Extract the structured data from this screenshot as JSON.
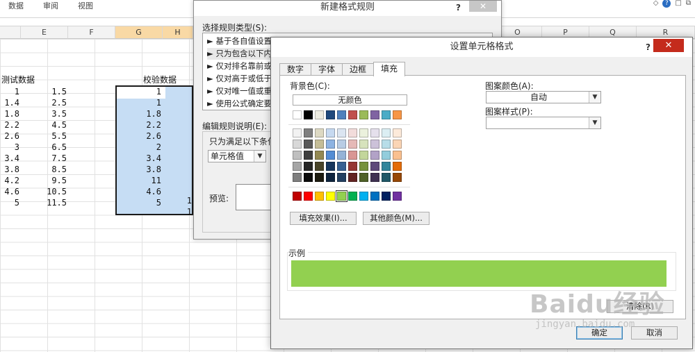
{
  "excel": {
    "ribbon_tabs": [
      "数据",
      "审阅",
      "视图"
    ],
    "columns_left": [
      "E",
      "F",
      "G",
      "H"
    ],
    "columns_right": [
      "O",
      "P",
      "Q",
      "R"
    ],
    "header_test": "测试数据",
    "header_check": "校验数据",
    "col_d": [
      "1",
      "1.4",
      "1.8",
      "2.2",
      "2.6",
      "3",
      "3.4",
      "3.8",
      "4.2",
      "4.6",
      "5"
    ],
    "col_e": [
      "1.5",
      "2.5",
      "3.5",
      "4.5",
      "5.5",
      "6.5",
      "7.5",
      "8.5",
      "9.5",
      "10.5",
      "11.5"
    ],
    "col_g": [
      "1",
      "1",
      "1.8",
      "2.2",
      "2.6",
      "2",
      "3.4",
      "3.8",
      "11",
      "4.6",
      "5"
    ],
    "col_h_partial": [
      "1",
      "1"
    ]
  },
  "back_dialog": {
    "title": "新建格式规则",
    "help": "?",
    "close": "✕",
    "select_rule_label": "选择规则类型(S):",
    "rule_types": [
      "► 基于各自值设置",
      "► 只为包含以下内",
      "► 仅对排名靠前或",
      "► 仅对高于或低于",
      "► 仅对唯一值或重",
      "► 使用公式确定要"
    ],
    "edit_desc_label": "编辑规则说明(E):",
    "only_format_label": "只为满足以下条件",
    "cell_value_combo": "单元格值",
    "preview_label": "预览:"
  },
  "front_dialog": {
    "title": "设置单元格格式",
    "help": "?",
    "close": "✕",
    "tabs": [
      "数字",
      "字体",
      "边框",
      "填充"
    ],
    "active_tab": "填充",
    "bg_color_label": "背景色(C):",
    "no_color_button": "无颜色",
    "fill_effects_button": "填充效果(I)...",
    "more_colors_button": "其他颜色(M)...",
    "pattern_color_label": "图案颜色(A):",
    "pattern_color_value": "自动",
    "pattern_style_label": "图案样式(P):",
    "pattern_style_value": "",
    "sample_label": "示例",
    "sample_color": "#92d050",
    "clear_button": "清除(R)",
    "ok_button": "确定",
    "cancel_button": "取消"
  },
  "palette": {
    "basic": [
      "#ffffff",
      "#000000",
      "#eeece1",
      "#1f497d",
      "#4f81bd",
      "#c0504d",
      "#9bbb59",
      "#8064a2",
      "#4bacc6",
      "#f79646"
    ],
    "tints": [
      [
        "#f2f2f2",
        "#7f7f7f",
        "#ddd9c3",
        "#c6d9f0",
        "#dbe5f1",
        "#f2dcdb",
        "#ebf1dd",
        "#e5e0ec",
        "#dbeef3",
        "#fdeada"
      ],
      [
        "#d8d8d8",
        "#595959",
        "#c4bd97",
        "#8db3e2",
        "#b8cce4",
        "#e5b9b7",
        "#d7e3bc",
        "#ccc1d9",
        "#b7dde8",
        "#fbd5b5"
      ],
      [
        "#bfbfbf",
        "#3f3f3f",
        "#938953",
        "#548dd4",
        "#95b3d7",
        "#d99694",
        "#c3d69b",
        "#b2a2c7",
        "#92cddc",
        "#fac08f"
      ],
      [
        "#a5a5a5",
        "#262626",
        "#494429",
        "#17365d",
        "#366092",
        "#953734",
        "#76923c",
        "#5f497a",
        "#31859b",
        "#e36c09"
      ],
      [
        "#7f7f7f",
        "#0c0c0c",
        "#1d1b10",
        "#0f243e",
        "#244061",
        "#632423",
        "#4f6128",
        "#3f3151",
        "#205867",
        "#974806"
      ]
    ],
    "standard": [
      "#c00000",
      "#ff0000",
      "#ffc000",
      "#ffff00",
      "#92d050",
      "#00b050",
      "#00b0f0",
      "#0070c0",
      "#002060",
      "#7030a0"
    ],
    "selected_standard_index": 4
  },
  "watermark": {
    "brand": "Baidu经验",
    "url": "jingyan.baidu.com"
  }
}
